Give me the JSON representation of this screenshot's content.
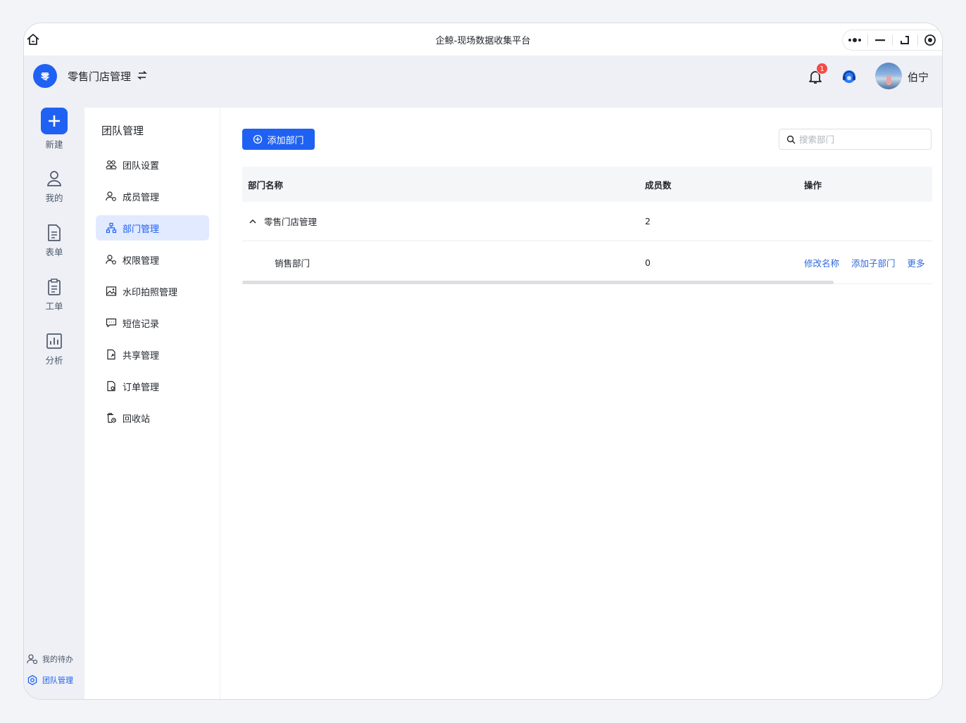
{
  "titlebar": {
    "title": "企鲸-现场数据收集平台"
  },
  "header": {
    "logo_text": "零",
    "org_name": "零售门店管理",
    "notification_count": "1",
    "user_name": "伯宁"
  },
  "rail": {
    "items": [
      {
        "label": "新建",
        "icon": "plus-icon"
      },
      {
        "label": "我的",
        "icon": "user-icon"
      },
      {
        "label": "表单",
        "icon": "form-icon"
      },
      {
        "label": "工单",
        "icon": "clipboard-icon"
      },
      {
        "label": "分析",
        "icon": "chart-icon"
      }
    ],
    "bottom": [
      {
        "label": "我的待办",
        "icon": "todo-user-icon"
      },
      {
        "label": "团队管理",
        "icon": "team-gear-icon"
      }
    ]
  },
  "subnav": {
    "title": "团队管理",
    "items": [
      {
        "label": "团队设置"
      },
      {
        "label": "成员管理"
      },
      {
        "label": "部门管理"
      },
      {
        "label": "权限管理"
      },
      {
        "label": "水印拍照管理"
      },
      {
        "label": "短信记录"
      },
      {
        "label": "共享管理"
      },
      {
        "label": "订单管理"
      },
      {
        "label": "回收站"
      }
    ]
  },
  "main": {
    "add_button": "添加部门",
    "search_placeholder": "搜索部门",
    "table": {
      "headers": [
        "部门名称",
        "成员数",
        "操作"
      ],
      "rows": [
        {
          "name": "零售门店管理",
          "count": "2"
        },
        {
          "name": "销售部门",
          "count": "0",
          "actions": [
            "修改名称",
            "添加子部门",
            "更多"
          ]
        }
      ]
    }
  },
  "colors": {
    "primary": "#1f61f2",
    "link": "#2f68d9",
    "header_bg": "#eef0f6"
  }
}
